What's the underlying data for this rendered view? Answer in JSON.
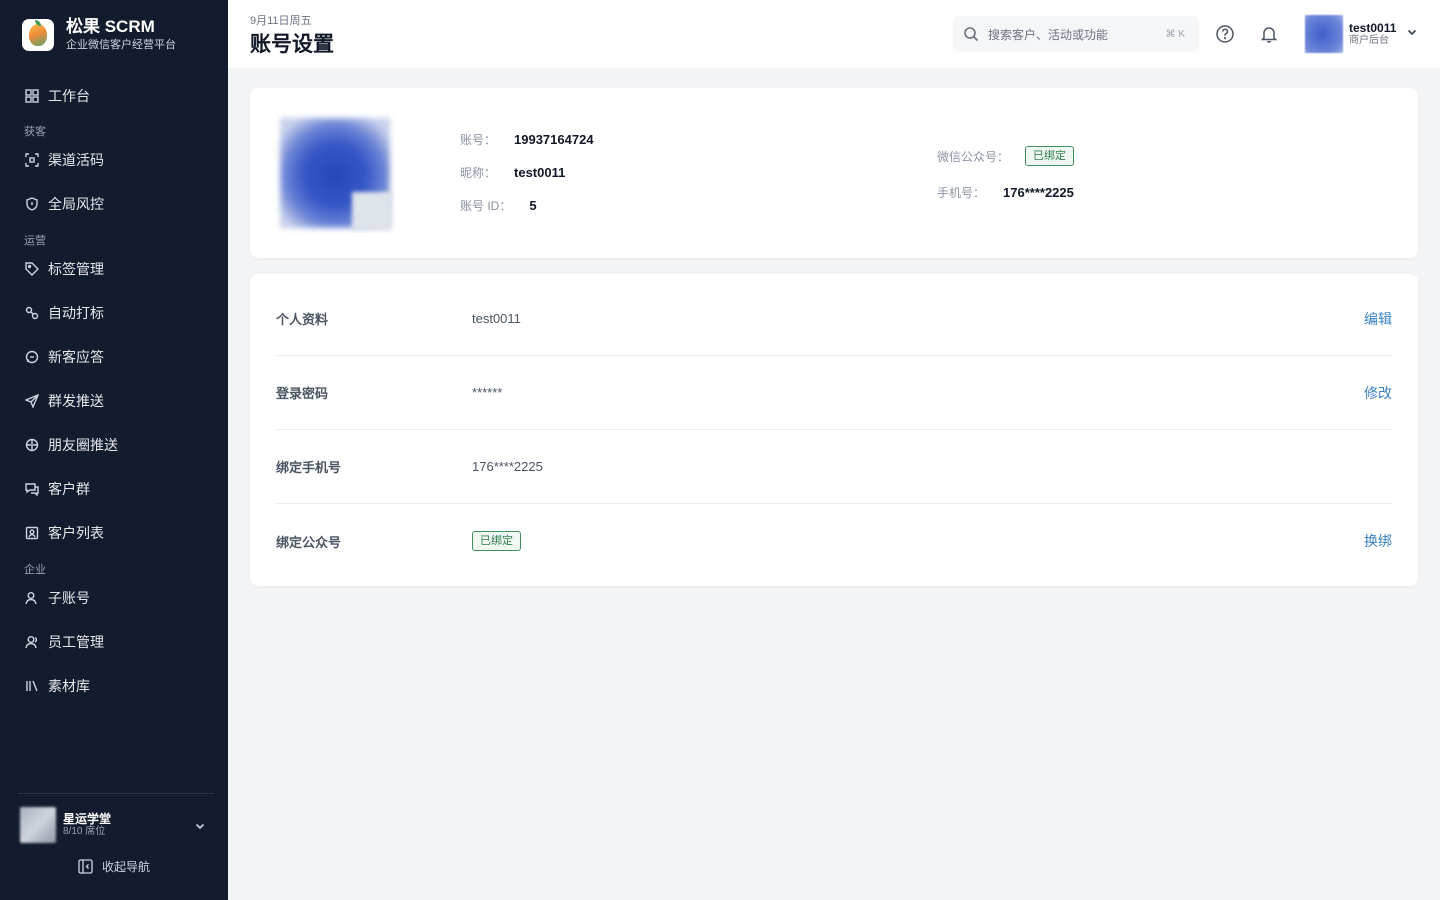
{
  "brand": {
    "title": "松果 SCRM",
    "subtitle": "企业微信客户经营平台"
  },
  "sidebar": {
    "items": [
      {
        "label": "工作台",
        "icon": "dashboard-icon"
      },
      {
        "label": "获客",
        "type": "group"
      },
      {
        "label": "渠道活码",
        "icon": "qrcode-scan-icon"
      },
      {
        "label": "全局风控",
        "icon": "shield-icon"
      },
      {
        "label": "运营",
        "type": "group"
      },
      {
        "label": "标签管理",
        "icon": "tag-icon"
      },
      {
        "label": "自动打标",
        "icon": "auto-tag-icon"
      },
      {
        "label": "新客应答",
        "icon": "chat-reply-icon"
      },
      {
        "label": "群发推送",
        "icon": "send-icon"
      },
      {
        "label": "朋友圈推送",
        "icon": "aperture-icon"
      },
      {
        "label": "客户群",
        "icon": "group-chat-icon"
      },
      {
        "label": "客户列表",
        "icon": "contact-card-icon"
      },
      {
        "label": "企业",
        "type": "group"
      },
      {
        "label": "子账号",
        "icon": "user-icon"
      },
      {
        "label": "员工管理",
        "icon": "staff-icon"
      },
      {
        "label": "素材库",
        "icon": "library-icon"
      }
    ],
    "org": {
      "name": "星运学堂",
      "seats": "8/10 席位"
    },
    "collapse_label": "收起导航"
  },
  "header": {
    "date": "9月11日周五",
    "title": "账号设置",
    "search_placeholder": "搜索客户、活动或功能",
    "search_shortcut": "⌘ K",
    "user": {
      "name": "test0011",
      "role": "商户后台"
    }
  },
  "account": {
    "account_label": "账号：",
    "account_value": "19937164724",
    "nickname_label": "昵称：",
    "nickname_value": "test0011",
    "id_label": "账号 ID：",
    "id_value": "5",
    "wechat_label": "微信公众号：",
    "wechat_value": "已绑定",
    "phone_label": "手机号：",
    "phone_value": "176****2225"
  },
  "settings": [
    {
      "label": "个人资料",
      "value": "test0011",
      "action": "编辑"
    },
    {
      "label": "登录密码",
      "value": "******",
      "action": "修改"
    },
    {
      "label": "绑定手机号",
      "value": "176****2225",
      "action": ""
    },
    {
      "label": "绑定公众号",
      "value": "已绑定",
      "action": "换绑"
    }
  ],
  "colors": {
    "sidebar_bg": "#131c2e",
    "link": "#3b82c4",
    "badge_green": "#2f7a4d"
  }
}
